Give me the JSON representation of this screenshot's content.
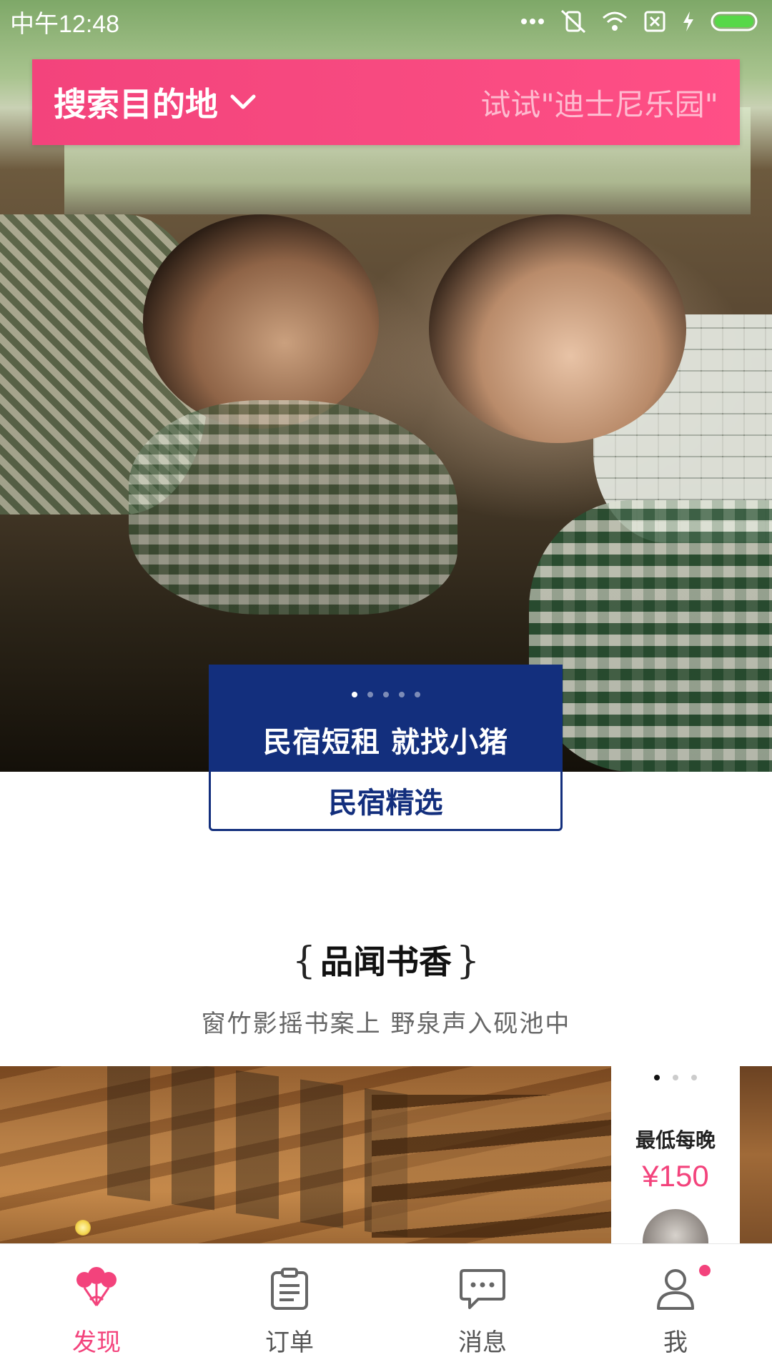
{
  "status_bar": {
    "time": "中午12:48",
    "icons": [
      "more-dots-icon",
      "vibrate-off-icon",
      "wifi-icon",
      "sim-card-x-icon",
      "charging-bolt-icon",
      "battery-icon"
    ]
  },
  "search": {
    "label": "搜索目的地",
    "chevron_icon": "chevron-down-icon",
    "hint": "试试\"迪士尼乐园\""
  },
  "banner": {
    "title": "民宿短租 就找小猪",
    "page_count": 5,
    "active_page": 1,
    "button_label": "民宿精选"
  },
  "section": {
    "brace_open": "{",
    "title": "品闻书香",
    "brace_close": "}",
    "subtitle": "窗竹影摇书案上 野泉声入砚池中"
  },
  "listing": {
    "page_count": 3,
    "active_page": 1,
    "price_label": "最低每晚",
    "price": "¥150"
  },
  "tabs": [
    {
      "label": "发现",
      "icon": "balloons-icon",
      "active": true
    },
    {
      "label": "订单",
      "icon": "clipboard-icon",
      "active": false
    },
    {
      "label": "消息",
      "icon": "chat-bubble-icon",
      "active": false
    },
    {
      "label": "我",
      "icon": "person-icon",
      "active": false,
      "badge": true
    }
  ],
  "colors": {
    "accent": "#f3437c",
    "banner_blue": "#132f7d",
    "tab_inactive": "#555555"
  }
}
